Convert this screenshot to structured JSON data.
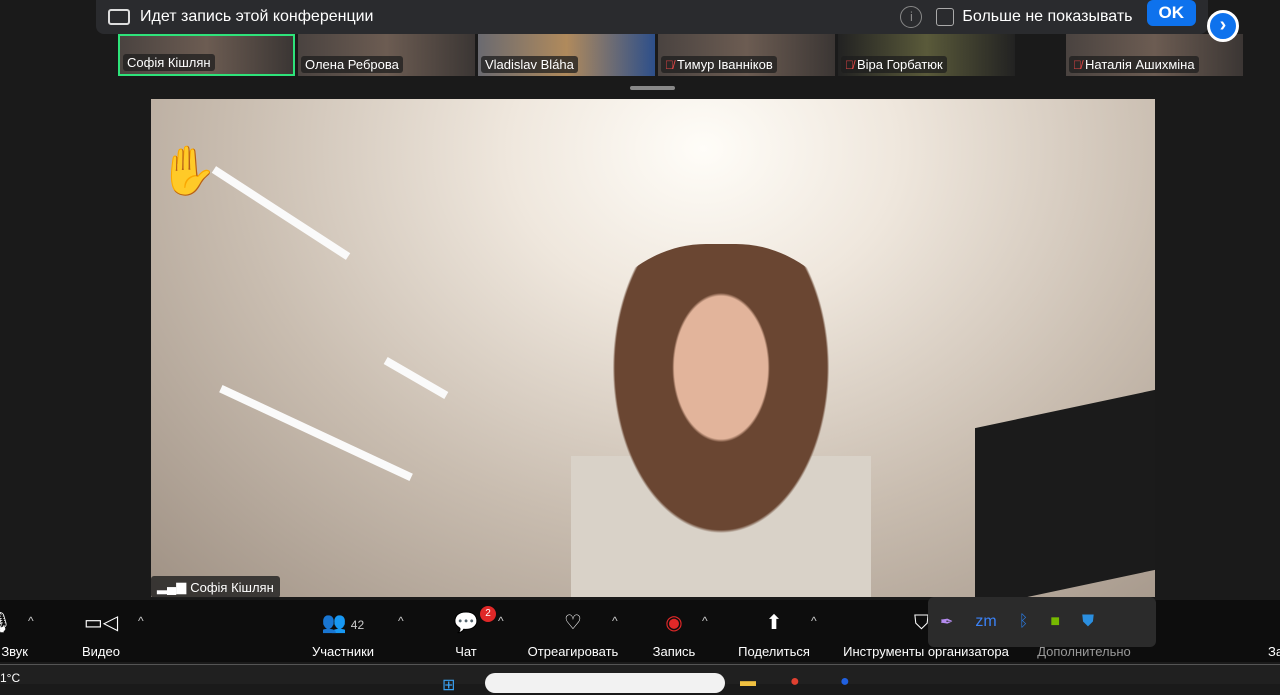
{
  "banner": {
    "text": "Идет запись этой конференции",
    "dont_show": "Больше не показывать",
    "ok": "OK"
  },
  "participants": [
    {
      "name": "Софія Кішлян",
      "muted": false,
      "active": true
    },
    {
      "name": "Олена Реброва",
      "muted": false
    },
    {
      "name": "Vladislav Bláha",
      "muted": false
    },
    {
      "name": "Тимур Іванніков",
      "muted": true
    },
    {
      "name": "Віра Горбатюк",
      "muted": true
    },
    {
      "name": "Наталія Ашихміна",
      "muted": true
    }
  ],
  "main_video": {
    "name": "Софія Кішлян",
    "reaction": "✋"
  },
  "toolbar": {
    "audio": "Звук",
    "video": "Видео",
    "participants": "Участники",
    "participants_count": "42",
    "chat": "Чат",
    "chat_badge": "2",
    "react": "Отреагировать",
    "record": "Запись",
    "share": "Поделиться",
    "host_tools": "Инструменты организатора",
    "more": "Дополнительно",
    "end": "За"
  },
  "taskbar": {
    "temperature": "1°C"
  }
}
